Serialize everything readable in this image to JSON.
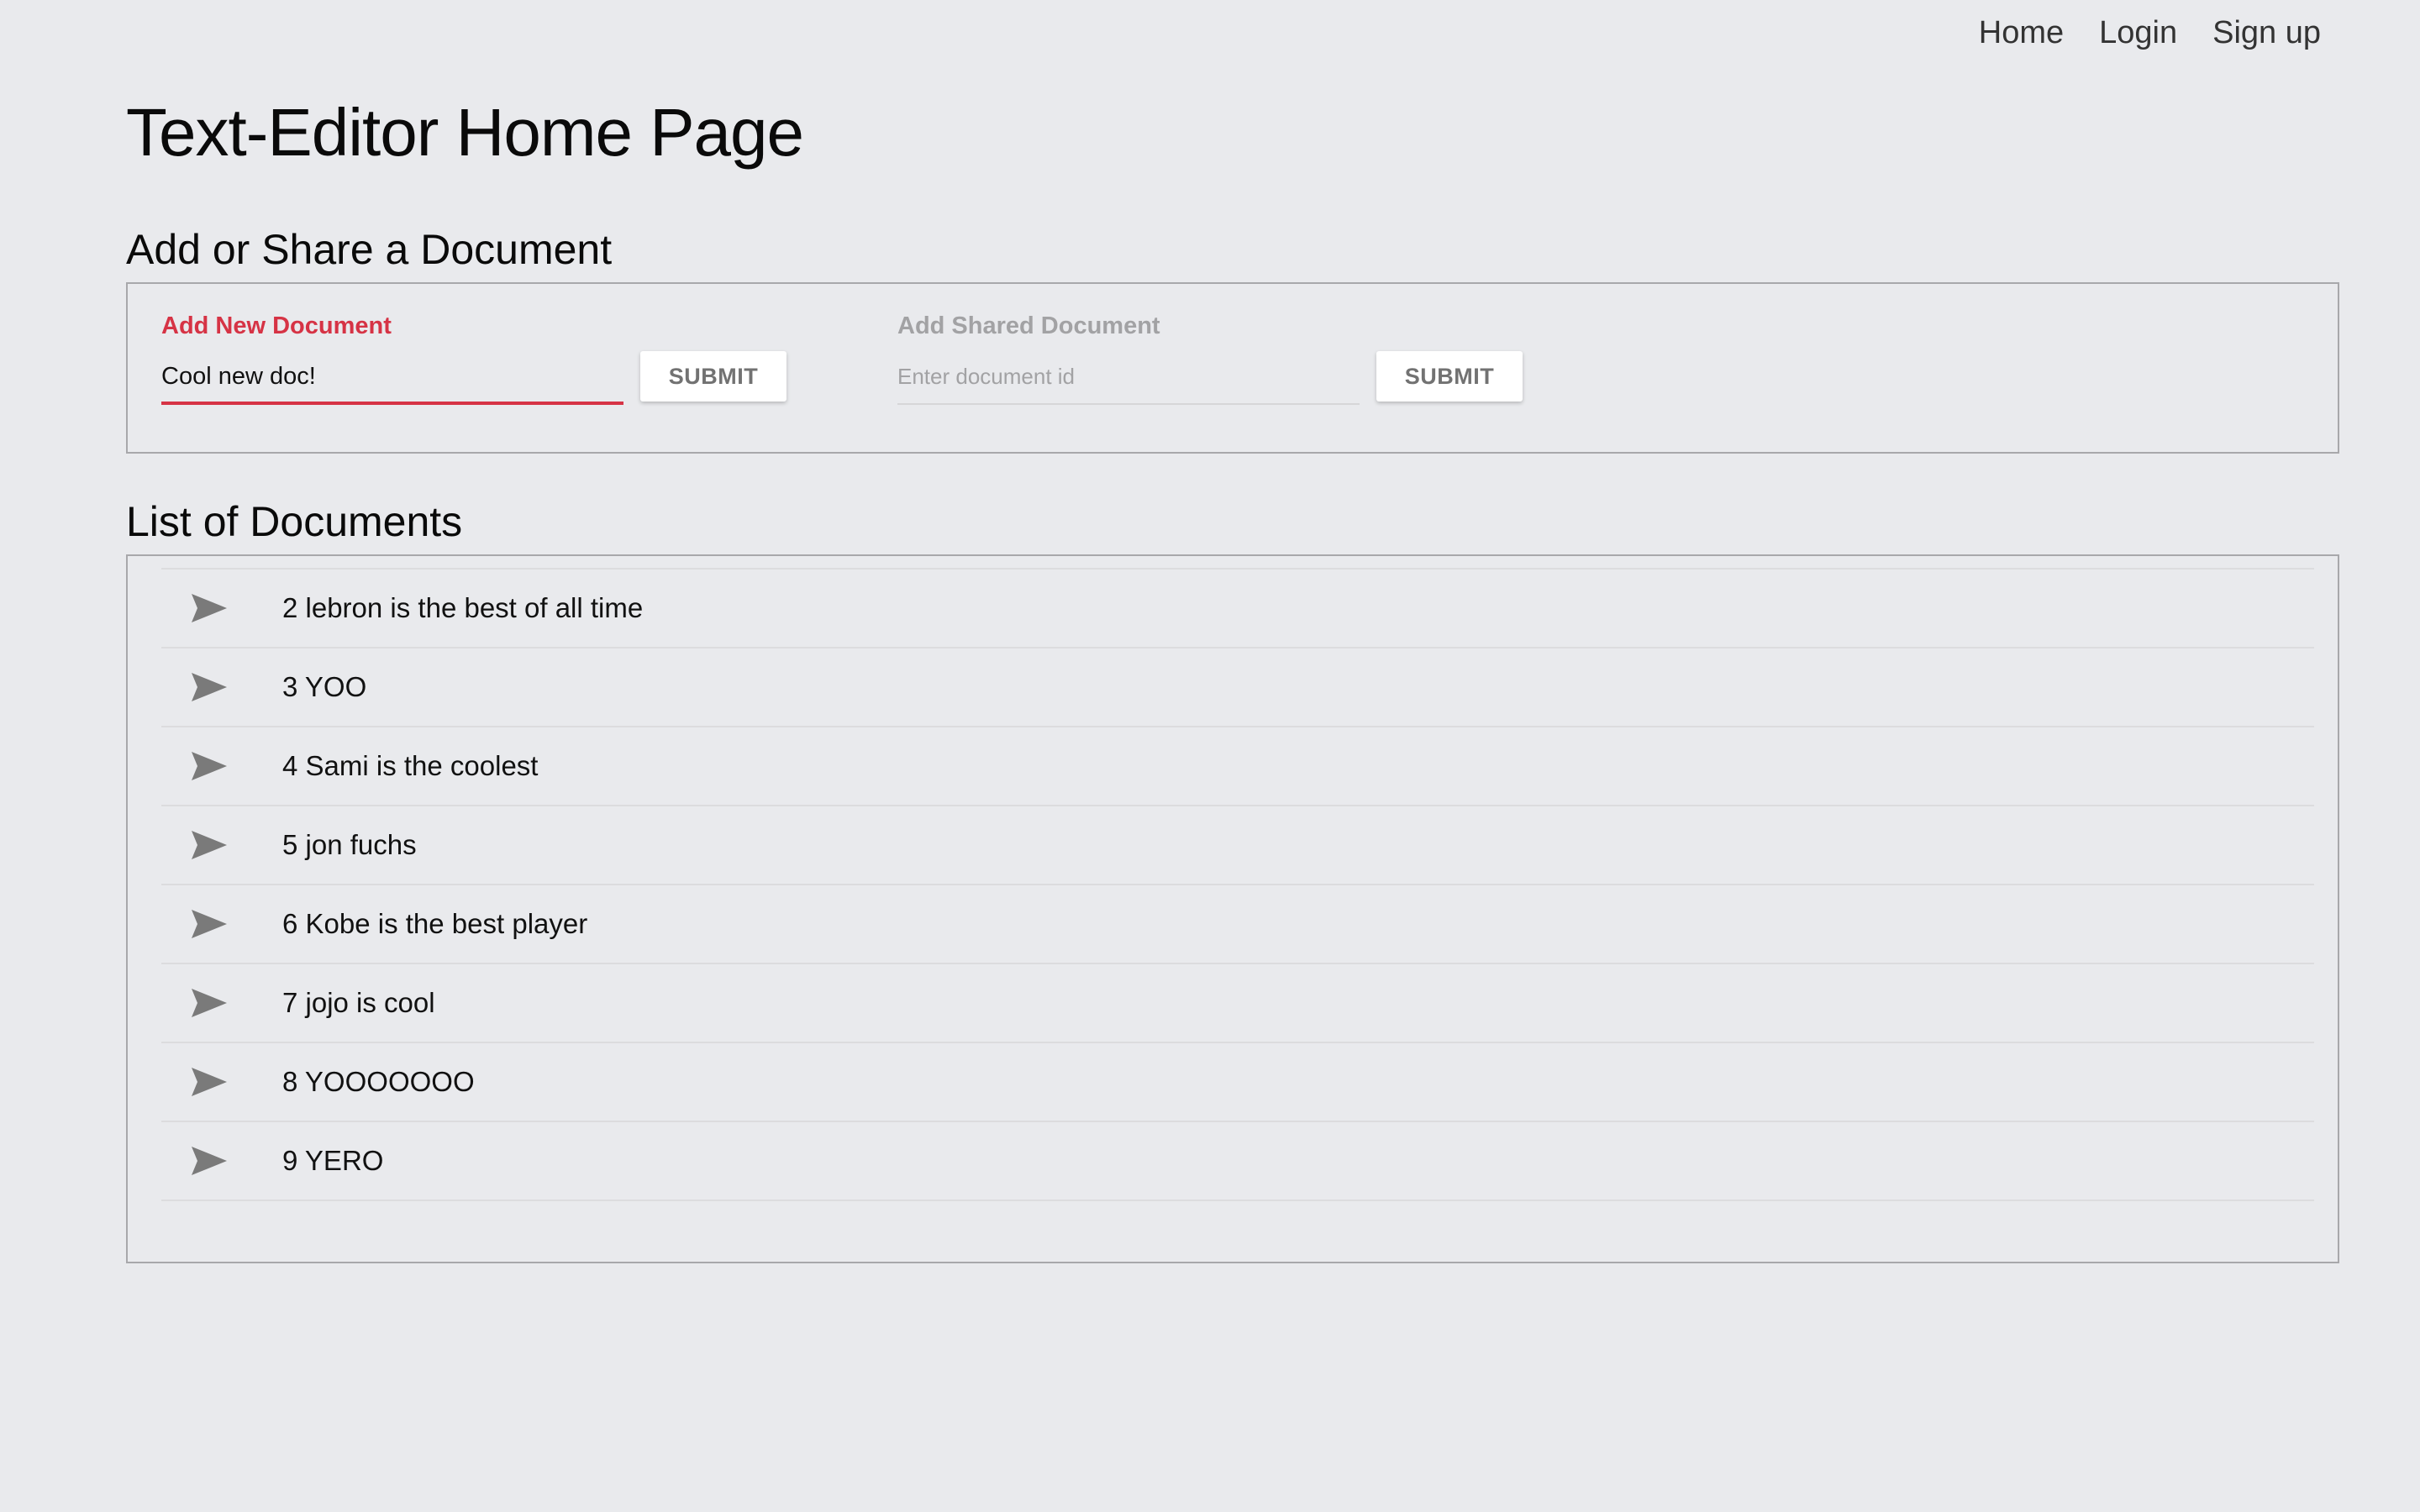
{
  "nav": {
    "home": "Home",
    "login": "Login",
    "signup": "Sign up"
  },
  "page_title": "Text-Editor Home Page",
  "add_section": {
    "title": "Add or Share a Document",
    "new_doc": {
      "label": "Add New Document",
      "value": "Cool new doc!",
      "submit": "SUBMIT"
    },
    "shared_doc": {
      "label": "Add Shared Document",
      "placeholder": "Enter document id",
      "value": "",
      "submit": "SUBMIT"
    }
  },
  "list_section": {
    "title": "List of Documents",
    "icon": "send-icon",
    "items": [
      "2 lebron is the best of all time",
      "3 YOO",
      "4 Sami is the coolest",
      "5 jon fuchs",
      "6 Kobe is the best player",
      "7 jojo is cool",
      "8 YOOOOOOO",
      "9 YERO"
    ]
  },
  "colors": {
    "accent": "#d63345",
    "background": "#e9eaed",
    "icon": "#7a7a7a"
  }
}
